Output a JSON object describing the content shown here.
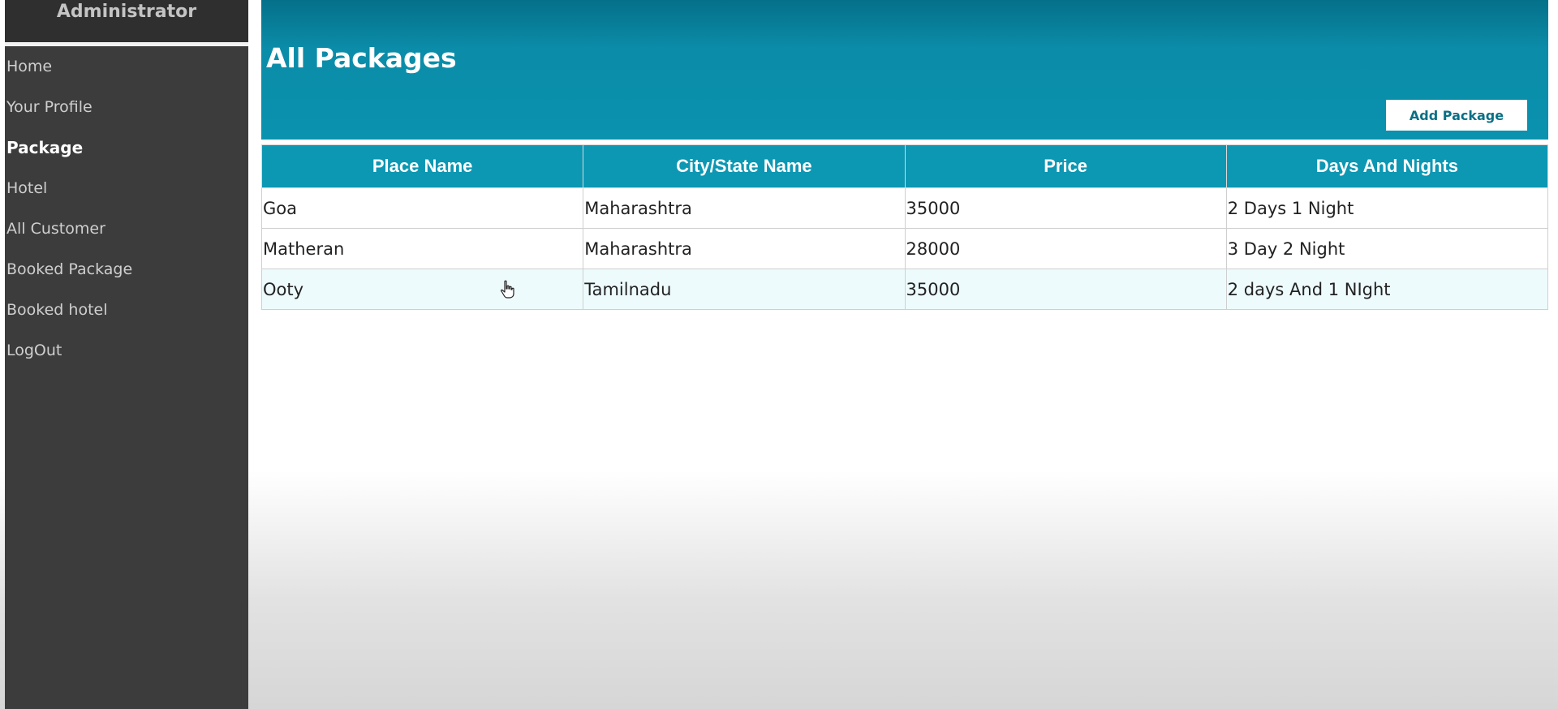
{
  "sidebar": {
    "title": "Administrator",
    "items": [
      {
        "label": "Home"
      },
      {
        "label": "Your Profile"
      },
      {
        "label": "Package"
      },
      {
        "label": "Hotel"
      },
      {
        "label": "All Customer"
      },
      {
        "label": "Booked Package"
      },
      {
        "label": "Booked hotel"
      },
      {
        "label": "LogOut"
      }
    ],
    "active": "Package"
  },
  "header": {
    "title": "All Packages",
    "add_button_label": "Add Package"
  },
  "table": {
    "columns": [
      "Place Name",
      "City/State Name",
      "Price",
      "Days And Nights"
    ],
    "rows": [
      [
        "Goa",
        "Maharashtra",
        "35000",
        "2 Days 1 Night"
      ],
      [
        "Matheran",
        "Maharashtra",
        "28000",
        "3 Day 2 Night"
      ],
      [
        "Ooty",
        "Tamilnadu",
        "35000",
        "2 days And 1 NIght"
      ]
    ]
  },
  "colors": {
    "header_bg": "#0a8ca8",
    "sidebar_bg": "#3c3c3c",
    "accent": "#0c97b3"
  },
  "icons": {
    "cursor": "hand-pointer-icon"
  }
}
